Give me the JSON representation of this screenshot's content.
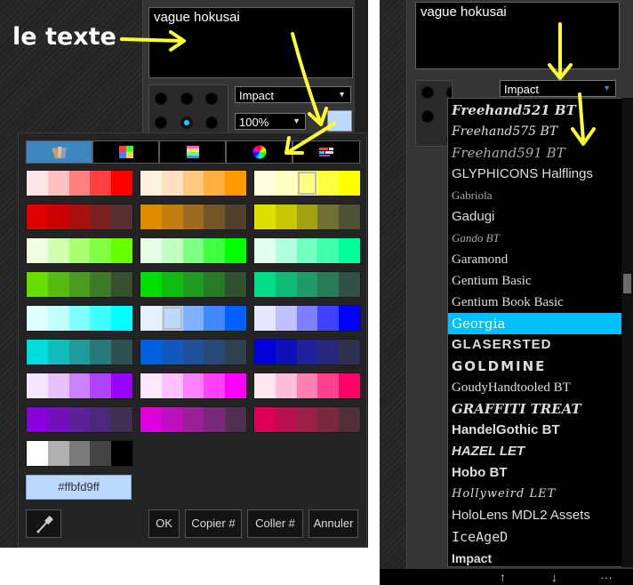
{
  "left_panel": {
    "text_value": "vague hokusai",
    "annotation": "le texte",
    "font_select": "Impact",
    "size_select": "100%",
    "color_preview": "#bcd9ff"
  },
  "color_picker": {
    "tabs": [
      "palette-icon",
      "bars-icon",
      "stripes-icon",
      "color-wheel-icon",
      "mixer-icon"
    ],
    "hex_value": "#ffbfd9ff",
    "buttons": {
      "ok": "OK",
      "copy": "Copier #",
      "paste": "Coller #",
      "cancel": "Annuler"
    },
    "swatches": [
      [
        [
          "#ffe6e6",
          "#ffbfbf",
          "#ff7f7f",
          "#ff3f3f",
          "#ff0000"
        ],
        [
          "#fff0e0",
          "#ffe0c0",
          "#ffc880",
          "#ffb040",
          "#ff9a00"
        ],
        [
          "#ffffe0",
          "#ffffc0",
          "#ffff80",
          "#ffff40",
          "#ffff00"
        ]
      ],
      [
        [
          "#e00000",
          "#c80000",
          "#a81010",
          "#7a2020",
          "#553030"
        ],
        [
          "#e08a00",
          "#c47e10",
          "#9e6a20",
          "#725528",
          "#504030"
        ],
        [
          "#e0e000",
          "#c8c800",
          "#a0a010",
          "#707030",
          "#505038"
        ]
      ],
      [
        [
          "#efffe0",
          "#d0ffb0",
          "#a8ff70",
          "#80ff40",
          "#66ff00"
        ],
        [
          "#e6ffe6",
          "#c0ffc0",
          "#80ff80",
          "#40ff40",
          "#00ff00"
        ],
        [
          "#e0fff0",
          "#b0ffe0",
          "#70ffc0",
          "#40ffaa",
          "#00ff99"
        ]
      ],
      [
        [
          "#66dd00",
          "#55bb10",
          "#4a9a20",
          "#3d7a28",
          "#354f30"
        ],
        [
          "#00dd00",
          "#10bb10",
          "#209a20",
          "#287a28",
          "#305030"
        ],
        [
          "#00dd88",
          "#10bb78",
          "#209a68",
          "#287a58",
          "#305048"
        ]
      ],
      [
        [
          "#e0ffff",
          "#c0ffff",
          "#80ffff",
          "#40ffff",
          "#00ffff"
        ],
        [
          "#e6f0ff",
          "#bcd9ff",
          "#80b0ff",
          "#4088ff",
          "#0060ff"
        ],
        [
          "#e6e6ff",
          "#c0c0ff",
          "#8080ff",
          "#4040ff",
          "#0000ff"
        ]
      ],
      [
        [
          "#00dddd",
          "#10bbbb",
          "#209a9a",
          "#287a7a",
          "#305050"
        ],
        [
          "#0060dd",
          "#1058bb",
          "#20509a",
          "#28487a",
          "#304050"
        ],
        [
          "#0000dd",
          "#1010bb",
          "#20209a",
          "#28287a",
          "#303050"
        ]
      ],
      [
        [
          "#f4e6ff",
          "#e6c0ff",
          "#cc80ff",
          "#b340ff",
          "#9900ff"
        ],
        [
          "#ffe6ff",
          "#ffc0ff",
          "#ff80ff",
          "#ff40ff",
          "#ff00ff"
        ],
        [
          "#ffe6ef",
          "#ffbfd9",
          "#ff80b3",
          "#ff408c",
          "#ff0066"
        ]
      ],
      [
        [
          "#8800dd",
          "#7410bb",
          "#60209a",
          "#4c287a",
          "#403050"
        ],
        [
          "#dd00dd",
          "#bb10bb",
          "#9a209a",
          "#7a287a",
          "#503050"
        ],
        [
          "#dd0055",
          "#bb1050",
          "#9a2048",
          "#7a2840",
          "#503038"
        ]
      ]
    ],
    "grays": [
      "#ffffff",
      "#b0b0b0",
      "#7a7a7a",
      "#444444",
      "#000000"
    ]
  },
  "right_panel": {
    "text_value": "vague hokusai",
    "font_select": "Impact",
    "font_list": [
      "Freehand521 BT",
      "Freehand575 BT",
      "Freehand591 BT",
      "GLYPHICONS Halflings",
      "Gabriola",
      "Gadugi",
      "Gando BT",
      "Garamond",
      "Gentium Basic",
      "Gentium Book Basic",
      "Georgia",
      "GLASERSTED",
      "GOLDMINE",
      "GoudyHandtooled BT",
      "GRAFFITI TREAT",
      "HandelGothic BT",
      "HAZEL LET",
      "Hobo BT",
      "Hollyweird LET",
      "HoloLens MDL2 Assets",
      "IceAgeD",
      "Impact"
    ],
    "selected_font": "Georgia",
    "bottom_icons": [
      "up-arrow-icon",
      "down-arrow-icon",
      "more-icon"
    ],
    "bottom_glyphs": [
      "↑",
      "↓",
      "···"
    ]
  }
}
